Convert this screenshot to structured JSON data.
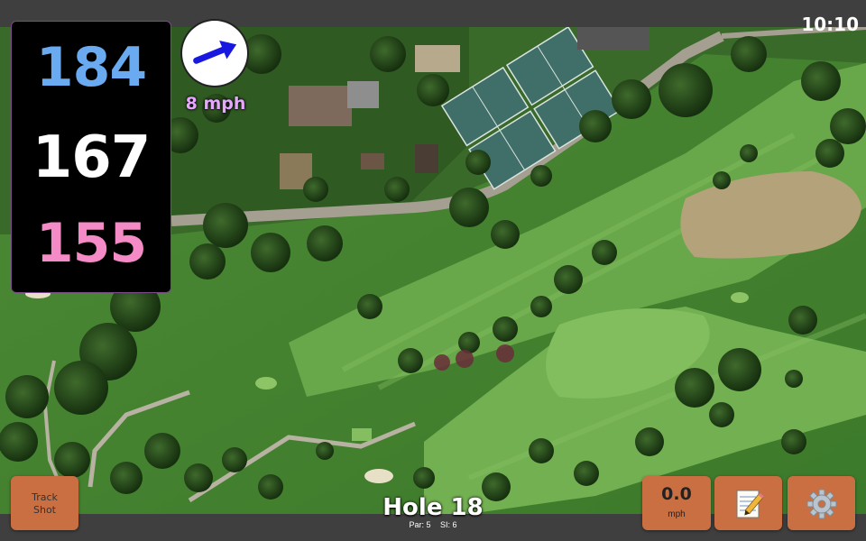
{
  "status_bar": {
    "time": "10:10"
  },
  "distances": {
    "back": "184",
    "center": "167",
    "front": "155"
  },
  "distance_colors": {
    "back": "#6aaaf0",
    "center": "#ffffff",
    "front": "#f58bc6"
  },
  "wind": {
    "speed_label": "8 mph",
    "direction_icon": "arrow-icon"
  },
  "hole": {
    "title": "Hole 18",
    "par": "Par: 5",
    "si": "SI: 6"
  },
  "buttons": {
    "track_shot_line1": "Track",
    "track_shot_line2": "Shot",
    "speed_value": "0.0",
    "speed_unit": "mph",
    "notes_icon": "notes-icon",
    "settings_icon": "gear-icon"
  },
  "colors": {
    "button": "#c96f42",
    "panel": "#000000",
    "wind_text": "#e6a8ff"
  }
}
